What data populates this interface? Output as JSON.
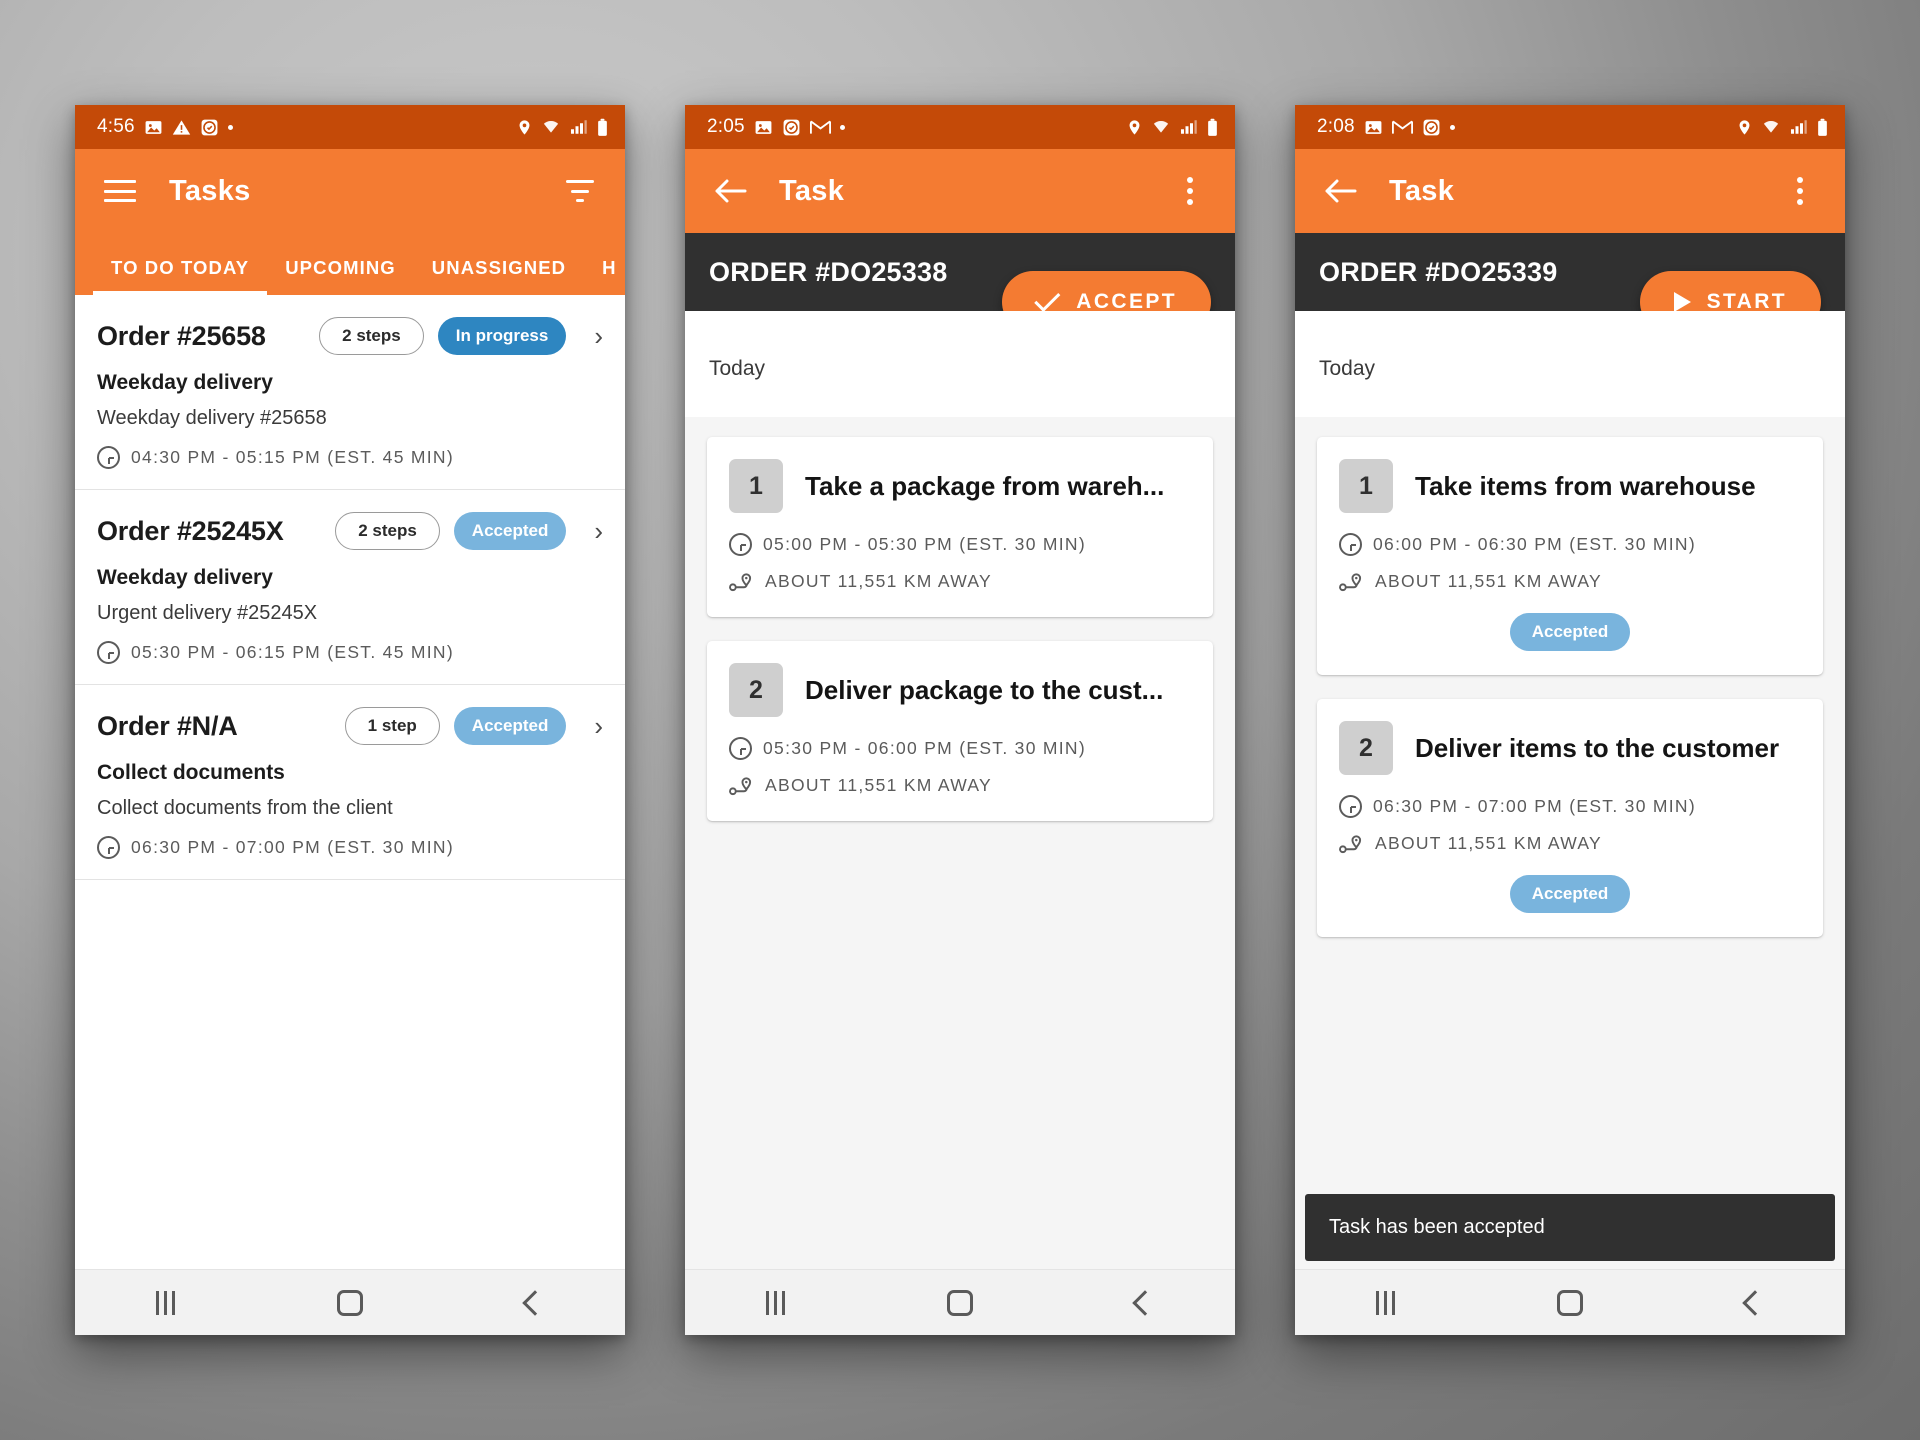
{
  "colors": {
    "status_bar": "#c44a08",
    "app_bar": "#f47b32",
    "accent": "#f47b32",
    "dark_bar": "#303030",
    "in_progress": "#2e86c1",
    "accepted": "#79b4dd"
  },
  "phone1": {
    "statusbar": {
      "time": "4:56",
      "icons": [
        "image-icon",
        "warning-icon",
        "clock-app-icon",
        "dot-icon"
      ],
      "right_icons": [
        "location-icon",
        "wifi-icon",
        "signal-icon",
        "battery-icon"
      ]
    },
    "appbar": {
      "title": "Tasks",
      "menu_icon": "hamburger-menu-icon",
      "filter_icon": "filter-icon"
    },
    "tabs": [
      {
        "label": "TO DO TODAY",
        "active": true
      },
      {
        "label": "UPCOMING",
        "active": false
      },
      {
        "label": "UNASSIGNED",
        "active": false
      },
      {
        "label": "H",
        "active": false
      }
    ],
    "tasks": [
      {
        "order": "Order #25658",
        "steps": "2 steps",
        "status": "In progress",
        "status_color": "#2e86c1",
        "subtitle": "Weekday delivery",
        "description": "Weekday delivery #25658",
        "time": "04:30 PM - 05:15 PM (EST. 45 MIN)"
      },
      {
        "order": "Order #25245X",
        "steps": "2 steps",
        "status": "Accepted",
        "status_color": "#79b4dd",
        "subtitle": "Weekday delivery",
        "description": "Urgent delivery #25245X",
        "time": "05:30 PM - 06:15 PM (EST. 45 MIN)"
      },
      {
        "order": "Order #N/A",
        "steps": "1 step",
        "status": "Accepted",
        "status_color": "#79b4dd",
        "subtitle": "Collect documents",
        "description": "Collect documents from the client",
        "time": "06:30 PM - 07:00 PM (EST. 30 MIN)"
      }
    ]
  },
  "phone2": {
    "statusbar": {
      "time": "2:05",
      "icons": [
        "image-icon",
        "clock-app-icon",
        "gmail-icon",
        "dot-icon"
      ]
    },
    "appbar": {
      "title": "Task",
      "back_icon": "arrow-back-icon",
      "overflow_icon": "overflow-menu-icon"
    },
    "order_title": "ORDER #DO25338",
    "action_button": {
      "label": "ACCEPT",
      "icon": "check-icon"
    },
    "today_label": "Today",
    "steps": [
      {
        "number": "1",
        "title": "Take a package from wareh...",
        "time": "05:00 PM - 05:30 PM (EST. 30 MIN)",
        "distance": "ABOUT 11,551 KM AWAY",
        "badge": ""
      },
      {
        "number": "2",
        "title": "Deliver package to the cust...",
        "time": "05:30 PM - 06:00 PM (EST. 30 MIN)",
        "distance": "ABOUT 11,551 KM AWAY",
        "badge": ""
      }
    ]
  },
  "phone3": {
    "statusbar": {
      "time": "2:08",
      "icons": [
        "image-icon",
        "gmail-icon",
        "clock-app-icon",
        "dot-icon"
      ]
    },
    "appbar": {
      "title": "Task",
      "back_icon": "arrow-back-icon",
      "overflow_icon": "overflow-menu-icon"
    },
    "order_title": "ORDER #DO25339",
    "action_button": {
      "label": "START",
      "icon": "play-icon"
    },
    "today_label": "Today",
    "steps": [
      {
        "number": "1",
        "title": "Take items from warehouse",
        "time": "06:00 PM - 06:30 PM (EST. 30 MIN)",
        "distance": "ABOUT 11,551 KM AWAY",
        "badge": "Accepted"
      },
      {
        "number": "2",
        "title": "Deliver items to the customer",
        "time": "06:30 PM - 07:00 PM (EST. 30 MIN)",
        "distance": "ABOUT 11,551 KM AWAY",
        "badge": "Accepted"
      }
    ],
    "snackbar": "Task has been accepted"
  },
  "navbar": {
    "recent_icon": "recent-apps-icon",
    "home_icon": "home-icon",
    "back_icon": "back-icon"
  }
}
